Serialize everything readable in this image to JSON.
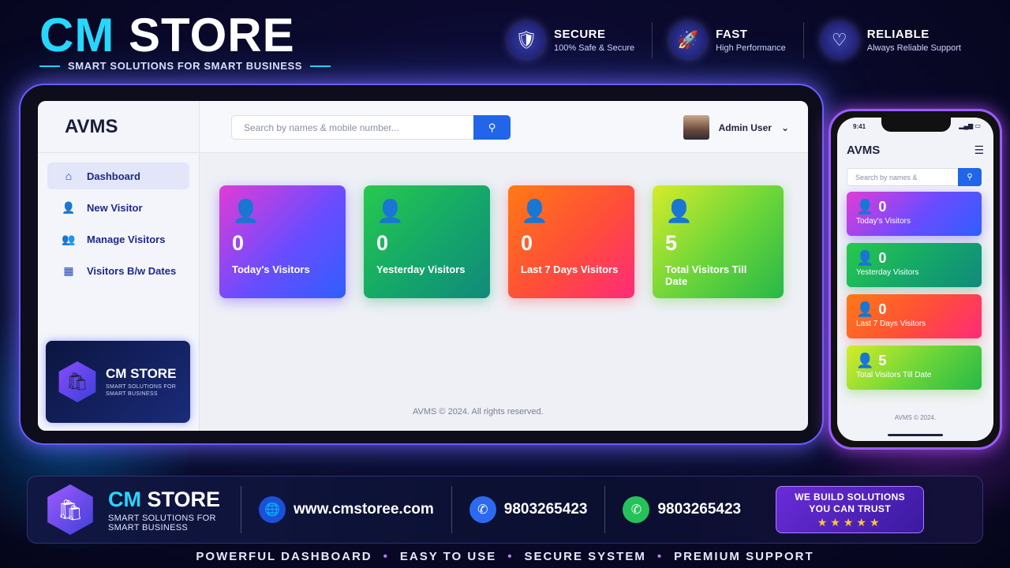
{
  "brand": {
    "cm": "CM",
    "store": "STORE",
    "subtitle": "SMART SOLUTIONS FOR SMART BUSINESS"
  },
  "features": [
    {
      "icon": "shield-check-icon",
      "title": "SECURE",
      "sub": "100% Safe & Secure"
    },
    {
      "icon": "rocket-icon",
      "title": "FAST",
      "sub": "High Performance"
    },
    {
      "icon": "support-icon",
      "title": "RELIABLE",
      "sub": "Always Reliable Support"
    }
  ],
  "app": {
    "logo": "AVMS",
    "search_placeholder": "Search by names & mobile number...",
    "user": "Admin User",
    "nav": [
      {
        "label": "Dashboard",
        "icon": "home-icon"
      },
      {
        "label": "New Visitor",
        "icon": "user-plus-icon"
      },
      {
        "label": "Manage Visitors",
        "icon": "users-icon"
      },
      {
        "label": "Visitors B/w Dates",
        "icon": "calendar-icon"
      }
    ],
    "promo": {
      "title": "CM STORE",
      "sub1": "SMART SOLUTIONS FOR",
      "sub2": "SMART BUSINESS"
    },
    "cards": [
      {
        "value": "0",
        "label": "Today's Visitors"
      },
      {
        "value": "0",
        "label": "Yesterday Visitors"
      },
      {
        "value": "0",
        "label": "Last 7 Days Visitors"
      },
      {
        "value": "5",
        "label": "Total Visitors Till Date"
      }
    ],
    "footer": "AVMS © 2024. All rights reserved."
  },
  "phone": {
    "time": "9:41",
    "logo": "AVMS",
    "search_placeholder": "Search by names &",
    "footer": "AVMS © 2024.",
    "cards": [
      {
        "value": "0",
        "label": "Today's Visitors"
      },
      {
        "value": "0",
        "label": "Yesterday Visitors"
      },
      {
        "value": "0",
        "label": "Last 7 Days Visitors"
      },
      {
        "value": "5",
        "label": "Total Visitors Till Date"
      }
    ]
  },
  "bottom": {
    "cm": "CM",
    "store": " STORE",
    "sub1": "SMART SOLUTIONS FOR",
    "sub2": "SMART BUSINESS",
    "website": "www.cmstoree.com",
    "phone": "9803265423",
    "whatsapp": "9803265423",
    "trust1": "WE BUILD SOLUTIONS",
    "trust2": "YOU CAN TRUST",
    "stars": "★★★★★"
  },
  "tagline": [
    "POWERFUL DASHBOARD",
    "EASY TO USE",
    "SECURE SYSTEM",
    "PREMIUM SUPPORT"
  ],
  "colors": {
    "accent": "#26d8ff",
    "primary": "#2166e8",
    "purple": "#9a5cff"
  }
}
